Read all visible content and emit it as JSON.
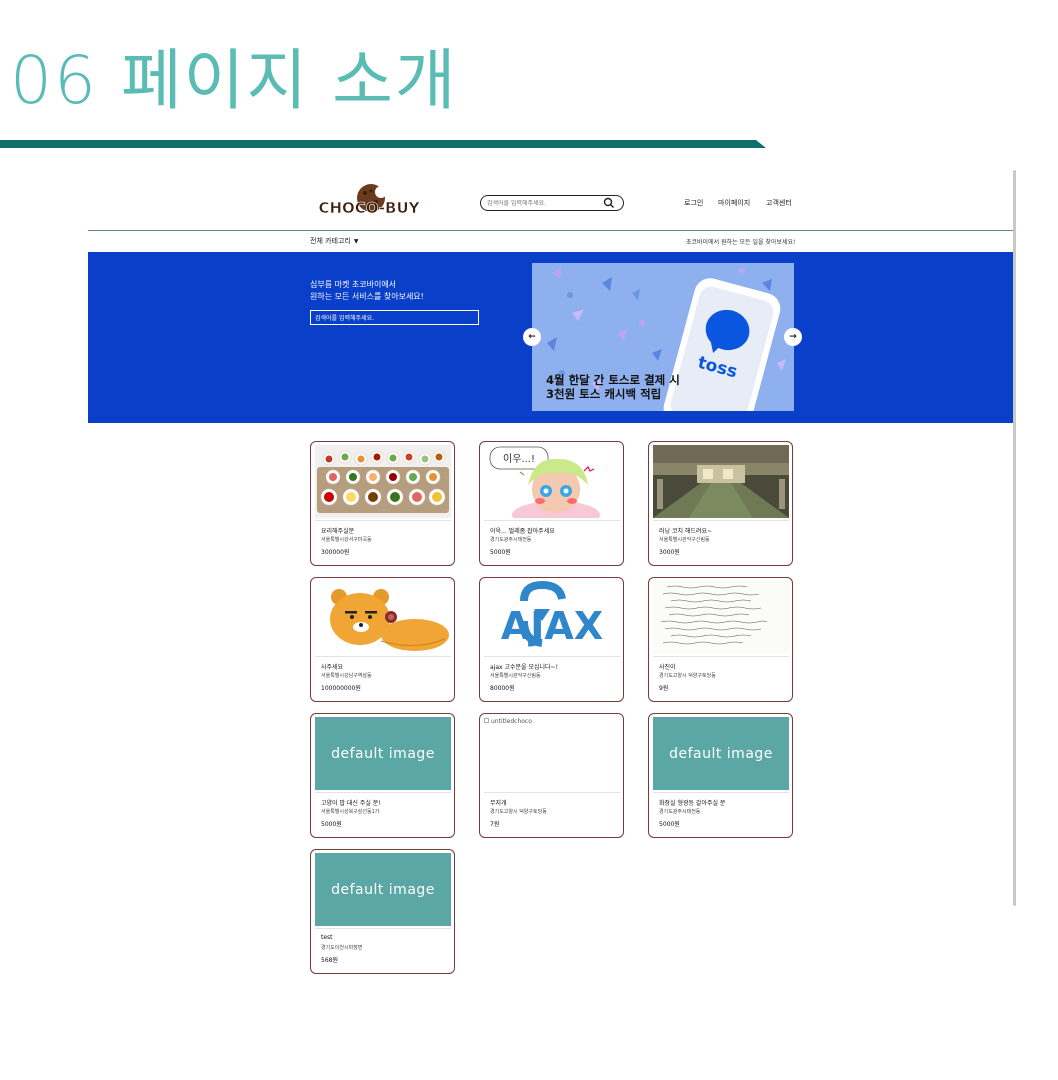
{
  "slide": {
    "title": "06 페이지 소개"
  },
  "header": {
    "logo_text": "CHOCO-BUY",
    "search_placeholder": "검색어를 입력해주세요.",
    "nav": {
      "login": "로그인",
      "mypage": "마이페이지",
      "customer_center": "고객센터"
    },
    "category_label": "전체 카테고리",
    "tagline": "초코바이에서 원하는 모든 일을 찾아보세요!"
  },
  "banner": {
    "heading_line1": "심부름 마켓 초코바이에서",
    "heading_line2": "원하는 모든 서비스를 찾아보세요!",
    "search_placeholder": "검색어를 입력해주세요.",
    "carousel": {
      "brand": "toss",
      "caption_line1": "4월 한달 간 토스로 결제 시",
      "caption_line2": "3천원 토스 캐시백 적립"
    }
  },
  "products": [
    {
      "title": "요리해주실분",
      "location": "서울특별시강서구마곡동",
      "price": "300000원",
      "image": "food-spread"
    },
    {
      "title": "이윽... 벌레좀 잡아주세요",
      "location": "경기도광주시태전동",
      "price": "5000원",
      "image": "cartoon-character",
      "image_caption": "이우...!"
    },
    {
      "title": "러닝 코치 해드려요~",
      "location": "서울특별시관악구신림동",
      "price": "3000원",
      "image": "parking-lot"
    },
    {
      "title": "사주세요",
      "location": "서울특별시강남구역삼동",
      "price": "100000000원",
      "image": "ryan-character"
    },
    {
      "title": "ajax 고수분을 모십니다~!",
      "location": "서울특별시관악구신림동",
      "price": "80000원",
      "image": "ajax-logo",
      "image_caption": "AJAX"
    },
    {
      "title": "사진이",
      "location": "경기도고양시 덕양구토당동",
      "price": "9원",
      "image": "handwritten-note"
    },
    {
      "title": "고양이 밥 대신 주실 분!",
      "location": "서울특별시성북구삼선동1가",
      "price": "5000원",
      "image": "default",
      "image_caption": "default image"
    },
    {
      "title": "무지개",
      "location": "경기도고양시 덕양구토당동",
      "price": "7원",
      "image": "broken",
      "image_caption": "untitledchoco"
    },
    {
      "title": "화장실 형광등 갈아주실 분",
      "location": "경기도광주시태전동",
      "price": "5000원",
      "image": "default",
      "image_caption": "default image"
    },
    {
      "title": "test",
      "location": "경기도이천시마장면",
      "price": "568원",
      "image": "default",
      "image_caption": "default image"
    }
  ]
}
